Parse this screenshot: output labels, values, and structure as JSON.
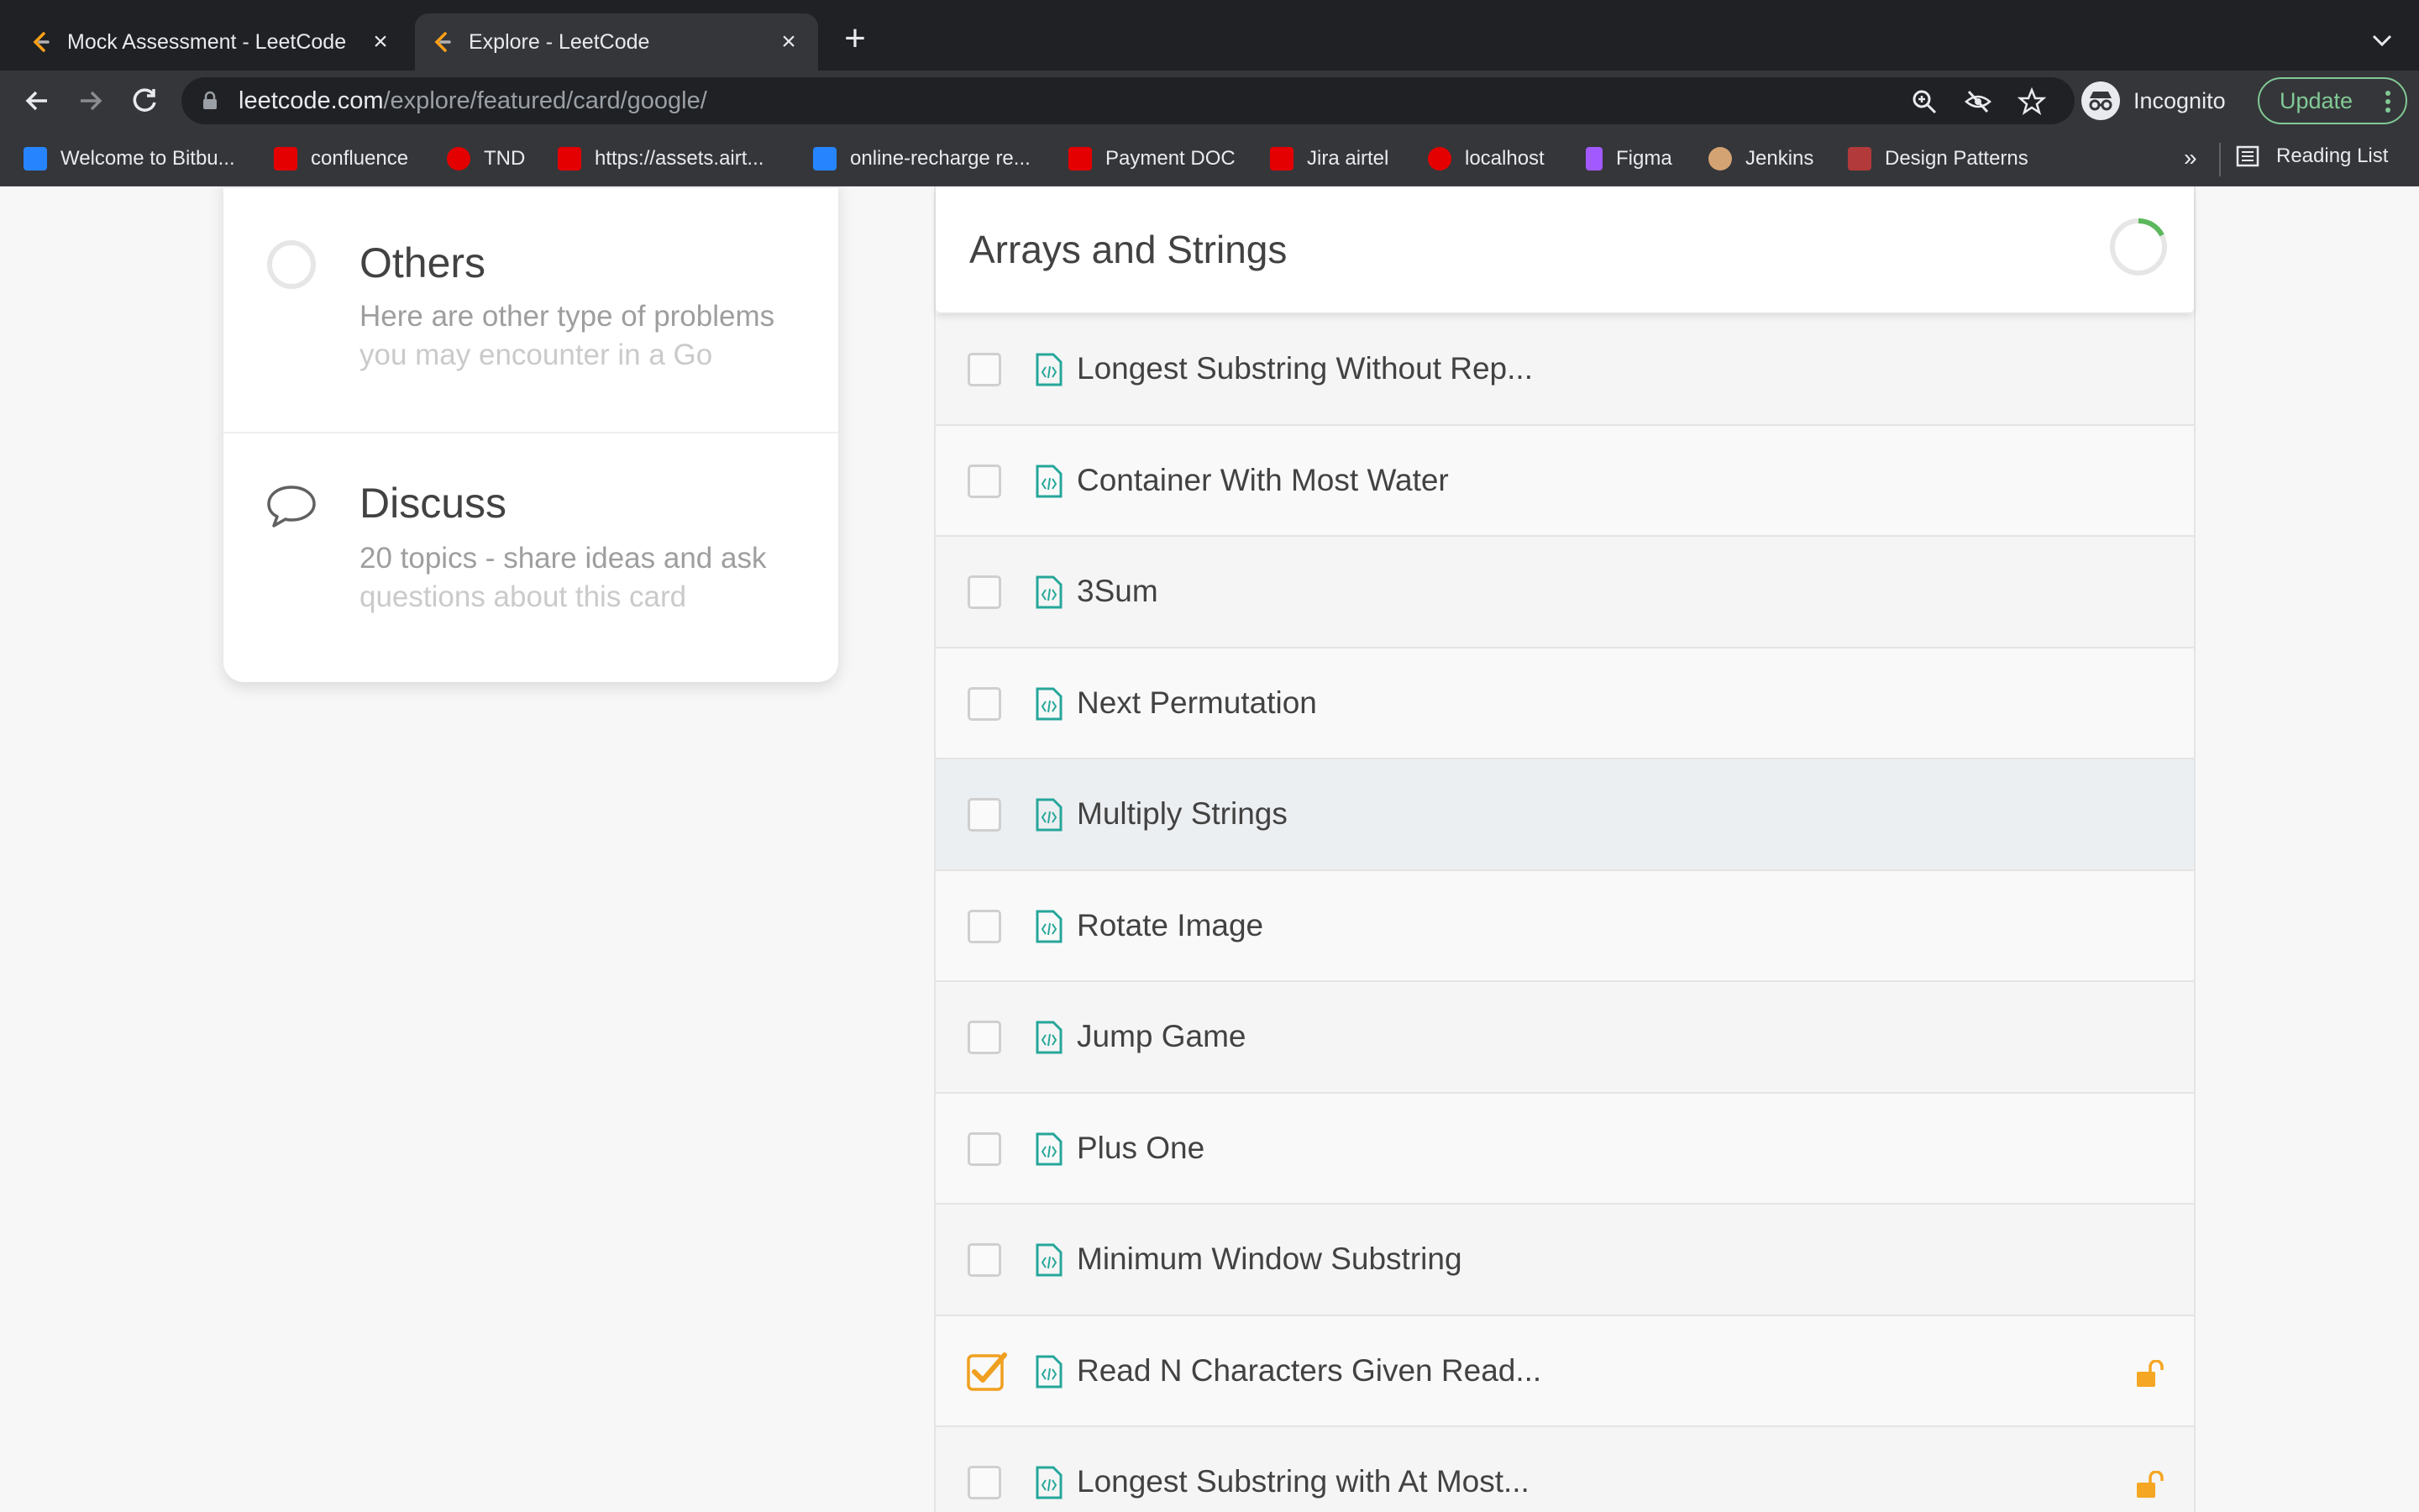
{
  "browser": {
    "tabs": [
      {
        "title": "Mock Assessment - LeetCode",
        "active": false
      },
      {
        "title": "Explore - LeetCode",
        "active": true
      }
    ],
    "new_tab": "+",
    "url": {
      "host": "leetcode.com",
      "path": "/explore/featured/card/google/"
    },
    "profile_label": "Incognito",
    "update_label": "Update",
    "bookmarks": [
      {
        "label": "Welcome to Bitbu...",
        "icon": "bitbucket-icon",
        "color": "#2684ff"
      },
      {
        "label": "confluence",
        "icon": "airtel-icon",
        "color": "#e40000"
      },
      {
        "label": "TND",
        "icon": "airtel-logo-icon",
        "color": "#e40000"
      },
      {
        "label": "https://assets.airt...",
        "icon": "airtel-icon",
        "color": "#e40000"
      },
      {
        "label": "online-recharge re...",
        "icon": "bitbucket-icon",
        "color": "#2684ff"
      },
      {
        "label": "Payment DOC",
        "icon": "airtel-icon",
        "color": "#e40000"
      },
      {
        "label": "Jira airtel",
        "icon": "airtel-icon",
        "color": "#e40000"
      },
      {
        "label": "localhost",
        "icon": "airtel-logo-icon",
        "color": "#e40000"
      },
      {
        "label": "Figma",
        "icon": "figma-icon",
        "color": "#a259ff"
      },
      {
        "label": "Jenkins",
        "icon": "jenkins-icon",
        "color": "#d4a373"
      },
      {
        "label": "Design Patterns",
        "icon": "design-patterns-icon",
        "color": "#b33a3a"
      }
    ],
    "bookmarks_overflow": "»",
    "reading_list": "Reading List"
  },
  "sidebar": {
    "others": {
      "title": "Others",
      "description": "Here are other type of problems you may encounter in a Go"
    },
    "discuss": {
      "title": "Discuss",
      "description": "20 topics - share ideas and ask questions about this card"
    }
  },
  "chapter": {
    "title": "Arrays and Strings",
    "problems": [
      {
        "name": "Longest Substring Without Rep...",
        "done": false,
        "locked": false
      },
      {
        "name": "Container With Most Water",
        "done": false,
        "locked": false
      },
      {
        "name": "3Sum",
        "done": false,
        "locked": false
      },
      {
        "name": "Next Permutation",
        "done": false,
        "locked": false
      },
      {
        "name": "Multiply Strings",
        "done": false,
        "locked": false
      },
      {
        "name": "Rotate Image",
        "done": false,
        "locked": false
      },
      {
        "name": "Jump Game",
        "done": false,
        "locked": false
      },
      {
        "name": "Plus One",
        "done": false,
        "locked": false
      },
      {
        "name": "Minimum Window Substring",
        "done": false,
        "locked": false
      },
      {
        "name": "Read N Characters Given Read...",
        "done": true,
        "locked": true
      },
      {
        "name": "Longest Substring with At Most...",
        "done": false,
        "locked": true
      }
    ]
  },
  "colors": {
    "accent_green": "#81c995",
    "doc_icon": "#26a69a",
    "check_orange": "#f0a020",
    "lock_orange": "#f5a623"
  }
}
